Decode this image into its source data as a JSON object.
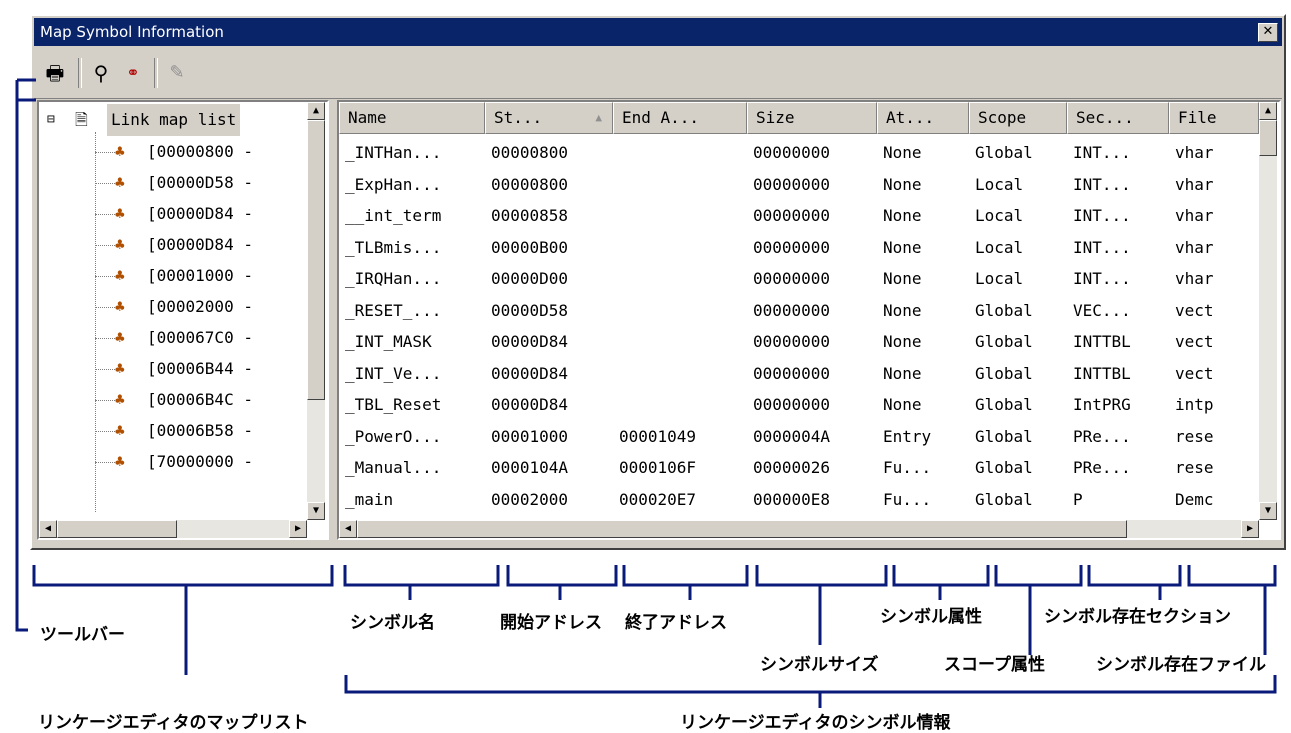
{
  "window": {
    "title": "Map Symbol Information"
  },
  "toolbar": {
    "icons": [
      "printer-icon",
      "binoculars-icon",
      "glasses-icon",
      "edit-icon"
    ]
  },
  "tree": {
    "root": "Link map list",
    "items": [
      "[00000800 -",
      "[00000D58 -",
      "[00000D84 -",
      "[00000D84 -",
      "[00001000 -",
      "[00002000 -",
      "[000067C0 -",
      "[00006B44 -",
      "[00006B4C -",
      "[00006B58 -",
      "[70000000 -"
    ]
  },
  "table": {
    "columns": [
      "Name",
      "St...",
      "End A...",
      "Size",
      "At...",
      "Scope",
      "Sec...",
      "File"
    ],
    "rows": [
      [
        "_INTHan...",
        "00000800",
        "",
        "00000000",
        "None",
        "Global",
        "INT...",
        "vhar"
      ],
      [
        "_ExpHan...",
        "00000800",
        "",
        "00000000",
        "None",
        "Local",
        "INT...",
        "vhar"
      ],
      [
        "__int_term",
        "00000858",
        "",
        "00000000",
        "None",
        "Local",
        "INT...",
        "vhar"
      ],
      [
        "_TLBmis...",
        "00000B00",
        "",
        "00000000",
        "None",
        "Local",
        "INT...",
        "vhar"
      ],
      [
        "_IRQHan...",
        "00000D00",
        "",
        "00000000",
        "None",
        "Local",
        "INT...",
        "vhar"
      ],
      [
        "_RESET_...",
        "00000D58",
        "",
        "00000000",
        "None",
        "Global",
        "VEC...",
        "vect"
      ],
      [
        "_INT_MASK",
        "00000D84",
        "",
        "00000000",
        "None",
        "Global",
        "INTTBL",
        "vect"
      ],
      [
        "_INT_Ve...",
        "00000D84",
        "",
        "00000000",
        "None",
        "Global",
        "INTTBL",
        "vect"
      ],
      [
        "_TBL_Reset",
        "00000D84",
        "",
        "00000000",
        "None",
        "Global",
        "IntPRG",
        "intp"
      ],
      [
        "_PowerO...",
        "00001000",
        "00001049",
        "0000004A",
        "Entry",
        "Global",
        "PRe...",
        "rese"
      ],
      [
        "_Manual...",
        "0000104A",
        "0000106F",
        "00000026",
        "Fu...",
        "Global",
        "PRe...",
        "rese"
      ],
      [
        "_main",
        "00002000",
        "000020E7",
        "000000E8",
        "Fu...",
        "Global",
        "P",
        "Demc"
      ]
    ]
  },
  "annotations": {
    "toolbar": "ツールバー",
    "symbol_name": "シンボル名",
    "start_address": "開始アドレス",
    "end_address": "終了アドレス",
    "symbol_size": "シンボルサイズ",
    "symbol_attr": "シンボル属性",
    "scope_attr": "スコープ属性",
    "symbol_section": "シンボル存在セクション",
    "symbol_file": "シンボル存在ファイル",
    "map_list": "リンケージエディタのマップリスト",
    "symbol_info": "リンケージエディタのシンボル情報"
  },
  "colors": {
    "titlebar": "#0a246a",
    "face": "#d4d0c8",
    "annotation": "#0a1a7a"
  }
}
